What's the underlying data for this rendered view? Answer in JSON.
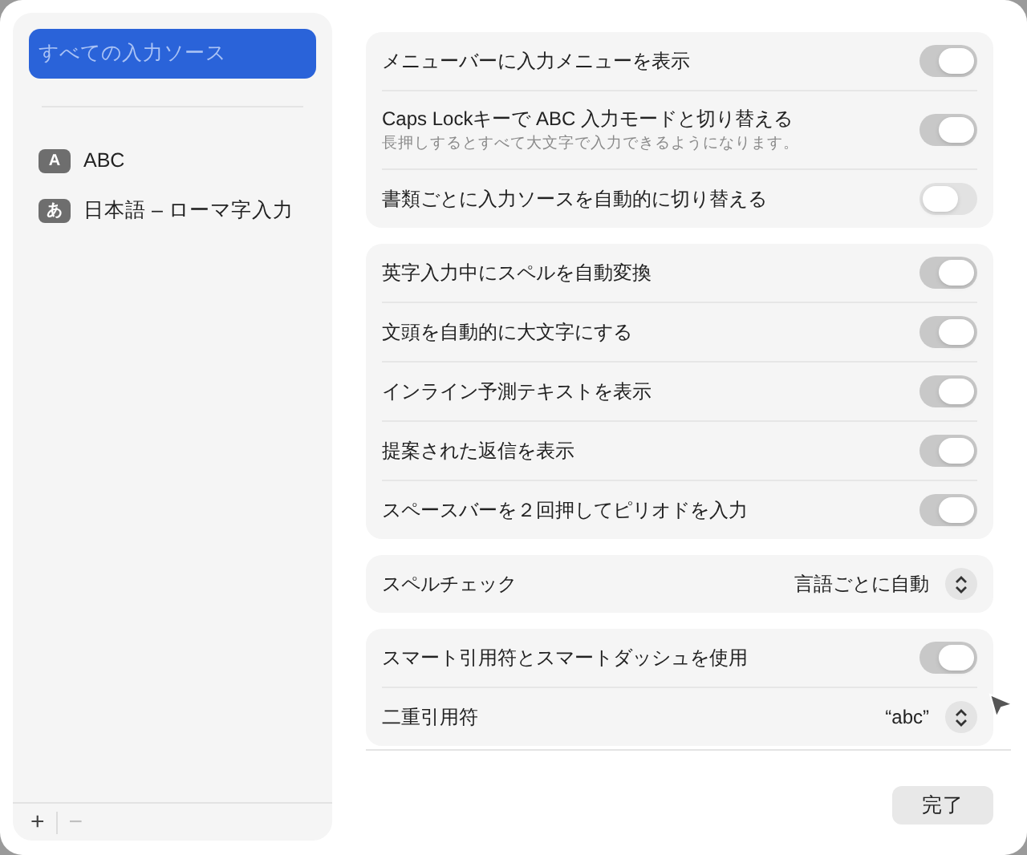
{
  "sidebar": {
    "items": [
      {
        "label": "すべての入力ソース",
        "selected": true
      },
      {
        "badge": "A",
        "label": "ABC",
        "selected": false
      },
      {
        "badge": "あ",
        "label": "日本語 – ローマ字入力",
        "selected": false
      }
    ],
    "buttons": [
      {
        "label": "+",
        "disabled": false
      },
      {
        "label": "−",
        "disabled": true
      }
    ]
  },
  "groups": [
    {
      "rows": [
        {
          "kind": "toggle",
          "label": "メニューバーに入力メニューを表示",
          "on": true
        },
        {
          "kind": "toggle",
          "label": "Caps Lockキーで ABC 入力モードと切り替える",
          "sublabel": "長押しするとすべて大文字で入力できるようになります。",
          "on": true
        },
        {
          "kind": "toggle",
          "label": "書類ごとに入力ソースを自動的に切り替える",
          "on": false
        }
      ]
    },
    {
      "rows": [
        {
          "kind": "toggle",
          "label": "英字入力中にスペルを自動変換",
          "on": true
        },
        {
          "kind": "toggle",
          "label": "文頭を自動的に大文字にする",
          "on": true
        },
        {
          "kind": "toggle",
          "label": "インライン予測テキストを表示",
          "on": true
        },
        {
          "kind": "toggle",
          "label": "提案された返信を表示",
          "on": true
        },
        {
          "kind": "toggle",
          "label": "スペースバーを２回押してピリオドを入力",
          "on": true
        }
      ]
    },
    {
      "rows": [
        {
          "kind": "popup",
          "label": "スペルチェック",
          "value": "言語ごとに自動"
        }
      ]
    },
    {
      "rows": [
        {
          "kind": "toggle",
          "label": "スマート引用符とスマートダッシュを使用",
          "on": true
        },
        {
          "kind": "popup",
          "label": "二重引用符",
          "value": "“abc”"
        }
      ]
    }
  ],
  "done_button": "完了"
}
